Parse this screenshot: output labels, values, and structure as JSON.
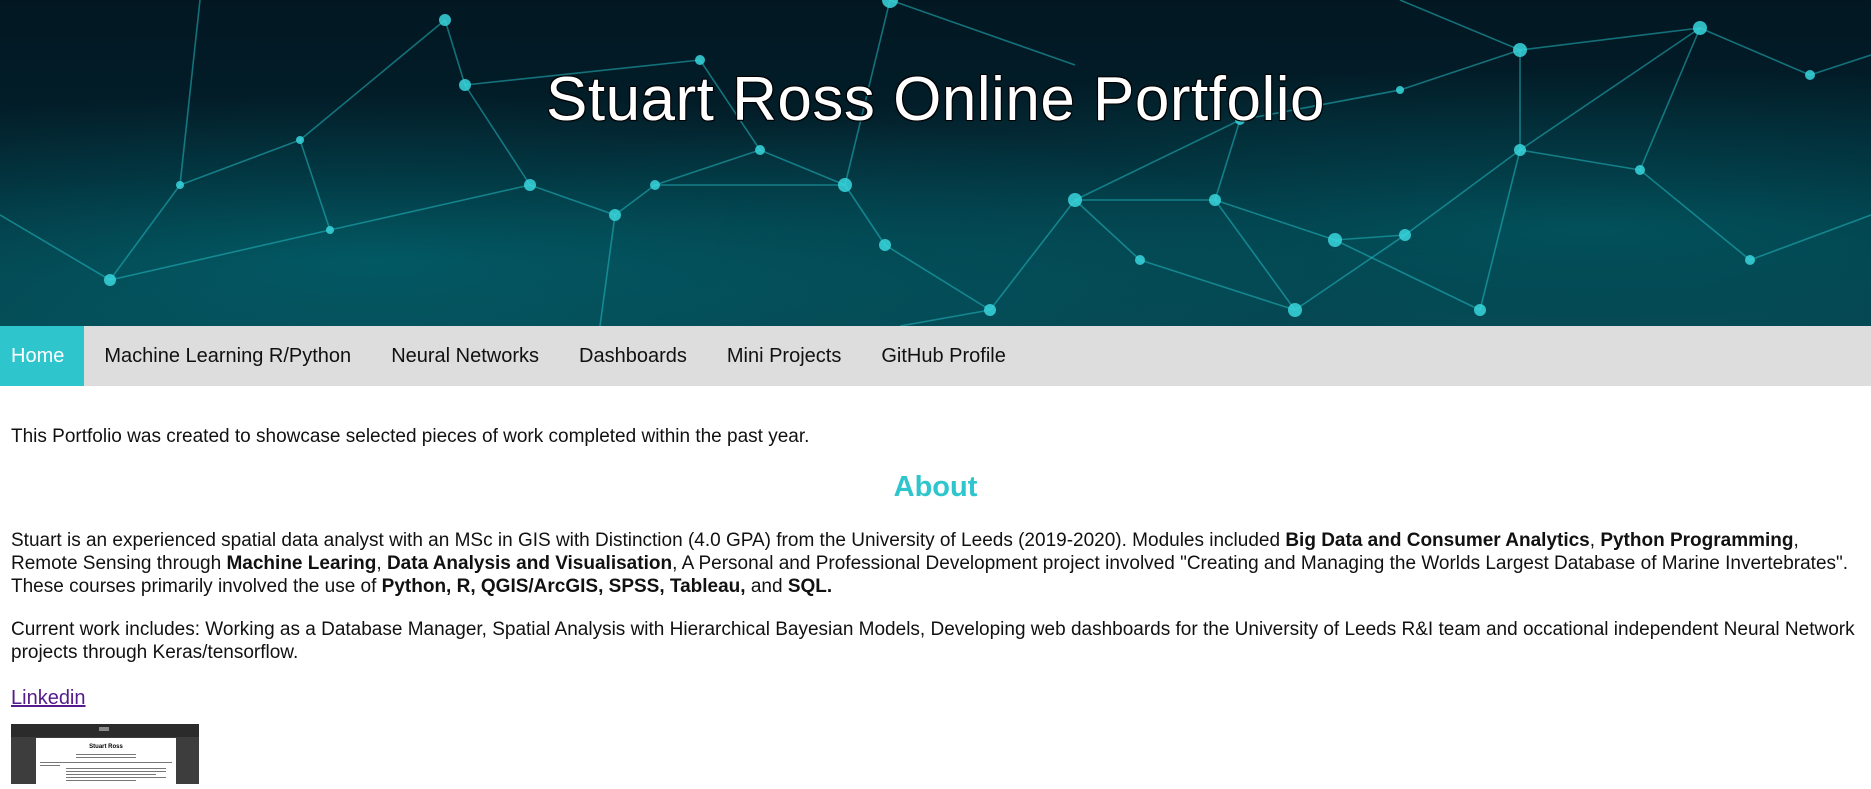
{
  "header": {
    "title": "Stuart Ross Online Portfolio"
  },
  "nav": {
    "items": [
      {
        "label": "Home",
        "active": true
      },
      {
        "label": "Machine Learning R/Python",
        "active": false
      },
      {
        "label": "Neural Networks",
        "active": false
      },
      {
        "label": "Dashboards",
        "active": false
      },
      {
        "label": "Mini Projects",
        "active": false
      },
      {
        "label": "GitHub Profile",
        "active": false
      }
    ]
  },
  "main": {
    "intro": "This Portfolio was created to showcase selected pieces of work completed within the past year.",
    "about_heading": "About",
    "about_paragraph": [
      {
        "text": "Stuart is an experienced spatial data analyst with an MSc in GIS with Distinction (4.0 GPA) from the University of Leeds (2019-2020). Modules included ",
        "bold": false
      },
      {
        "text": "Big Data and Consumer Analytics",
        "bold": true
      },
      {
        "text": ", ",
        "bold": false
      },
      {
        "text": "Python Programming",
        "bold": true
      },
      {
        "text": ", Remote Sensing through ",
        "bold": false
      },
      {
        "text": "Machine Learing",
        "bold": true
      },
      {
        "text": ", ",
        "bold": false
      },
      {
        "text": "Data Analysis and Visualisation",
        "bold": true
      },
      {
        "text": ", A Personal and Professional Development project involved \"Creating and Managing the Worlds Largest Database of Marine Invertebrates\". These courses primarily involved the use of ",
        "bold": false
      },
      {
        "text": "Python, R, QGIS/ArcGIS, SPSS, Tableau,",
        "bold": true
      },
      {
        "text": " and ",
        "bold": false
      },
      {
        "text": "SQL.",
        "bold": true
      }
    ],
    "current_work": "Current work includes: Working as a Database Manager, Spatial Analysis with Hierarchical Bayesian Models, Developing web dashboards for the University of Leeds R&I team and occational independent Neural Network projects through Keras/tensorflow.",
    "linkedin_label": "Linkedin",
    "cv_thumbnail_name": "Stuart Ross"
  },
  "colors": {
    "accent": "#2ec5cc",
    "navbar_bg": "#dddddd",
    "visited_link": "#551a8b"
  }
}
